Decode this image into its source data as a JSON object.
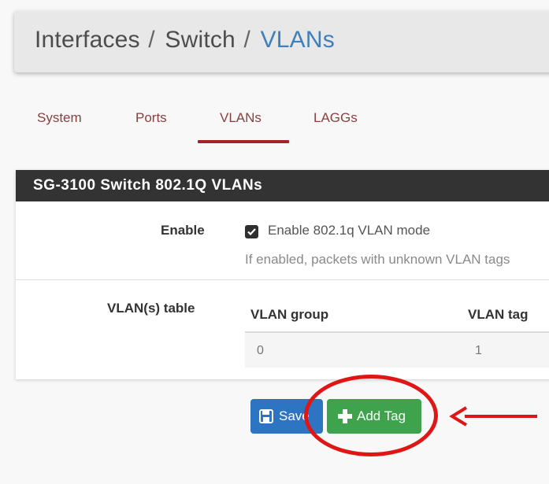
{
  "breadcrumb": {
    "part1": "Interfaces",
    "sep1": "/",
    "part2": "Switch",
    "sep2": "/",
    "current": "VLANs"
  },
  "tabs": [
    {
      "label": "System"
    },
    {
      "label": "Ports"
    },
    {
      "label": "VLANs",
      "active": true
    },
    {
      "label": "LAGGs"
    }
  ],
  "panel": {
    "title": "SG-3100 Switch 802.1Q VLANs",
    "enable": {
      "label": "Enable",
      "checkbox_label": "Enable 802.1q VLAN mode",
      "checked": true,
      "help": "If enabled, packets with unknown VLAN tags"
    },
    "vlan_table": {
      "label": "VLAN(s) table",
      "headers": [
        "VLAN group",
        "VLAN tag"
      ],
      "rows": [
        [
          "0",
          "1"
        ]
      ]
    }
  },
  "buttons": {
    "save": "Save",
    "add_tag": "Add Tag"
  },
  "colors": {
    "accent_tab": "#a2232a",
    "breadcrumb_current": "#3f7fbc",
    "save_button": "#2d74c2",
    "add_button": "#3fa34d",
    "annotation": "#e01616"
  }
}
